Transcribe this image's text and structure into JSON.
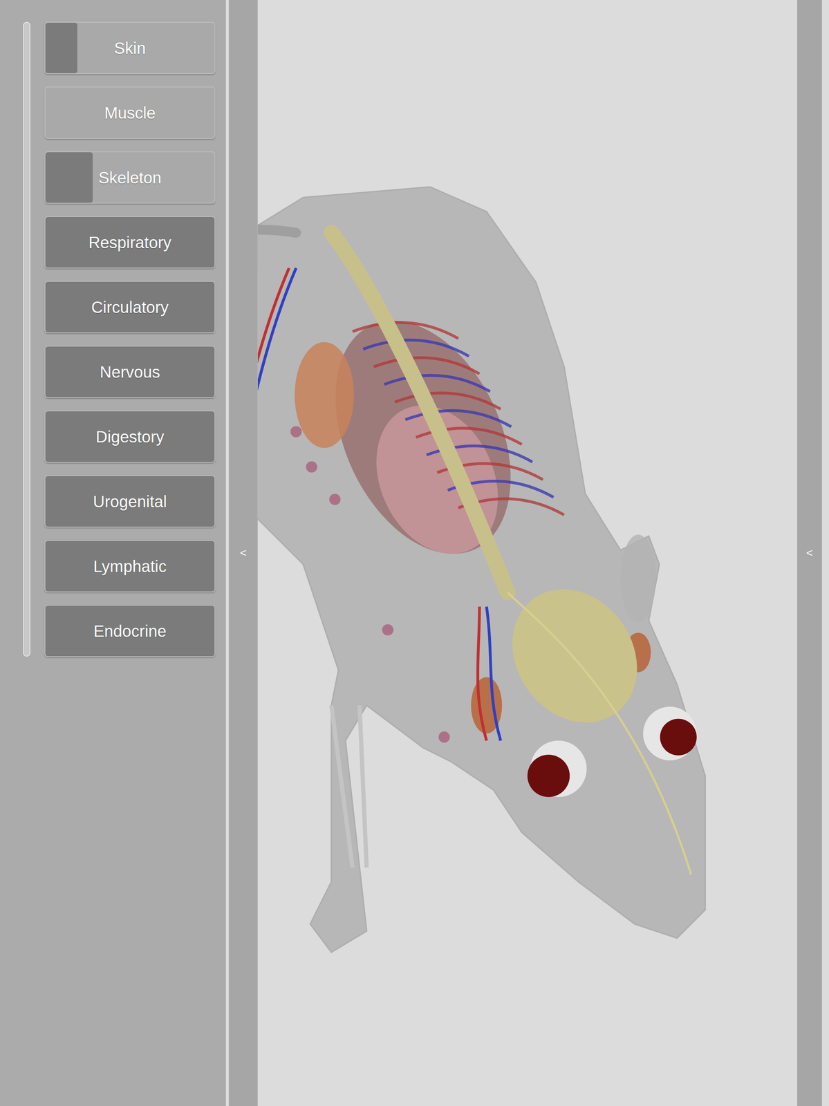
{
  "layer_panel": {
    "buttons": [
      {
        "label": "Skin",
        "level": 0.19
      },
      {
        "label": "Muscle",
        "level": 0
      },
      {
        "label": "Skeleton",
        "level": 0.28
      },
      {
        "label": "Respiratory",
        "level": 1
      },
      {
        "label": "Circulatory",
        "level": 1
      },
      {
        "label": "Nervous",
        "level": 1
      },
      {
        "label": "Digestory",
        "level": 1
      },
      {
        "label": "Urogenital",
        "level": 1
      },
      {
        "label": "Lymphatic",
        "level": 1
      },
      {
        "label": "Endocrine",
        "level": 1
      }
    ]
  },
  "left_toggle": {
    "label": "<"
  },
  "right_toggle": {
    "label": "<"
  }
}
